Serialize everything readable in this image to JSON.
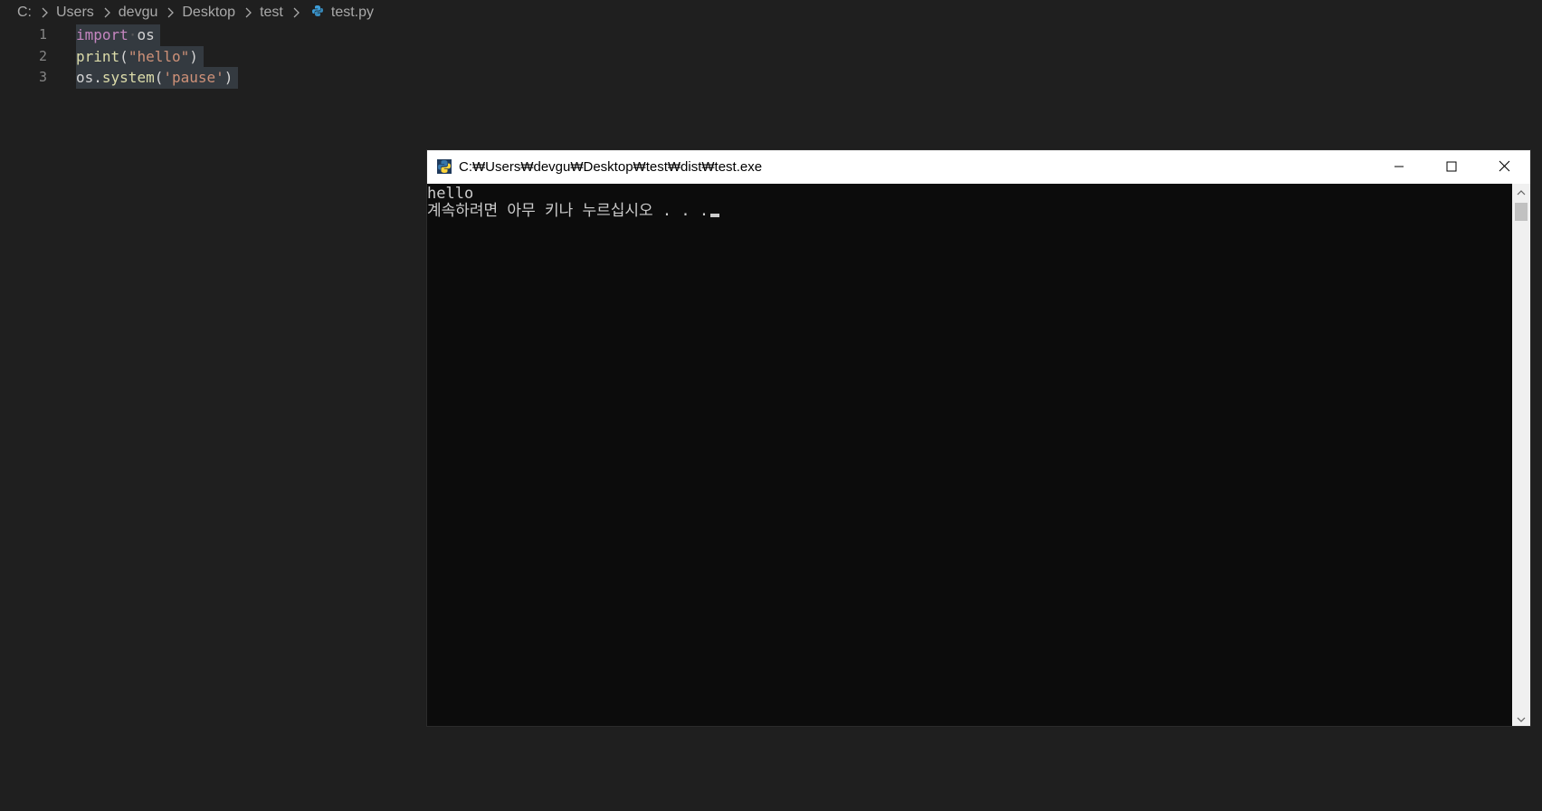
{
  "breadcrumb": {
    "items": [
      "C:",
      "Users",
      "devgu",
      "Desktop",
      "test"
    ],
    "file": "test.py"
  },
  "editor": {
    "lines": [
      {
        "number": "1",
        "tokens": [
          {
            "text": "import",
            "kind": "kw"
          },
          {
            "text": "·",
            "kind": "ws"
          },
          {
            "text": "os",
            "kind": "id"
          }
        ]
      },
      {
        "number": "2",
        "tokens": [
          {
            "text": "print",
            "kind": "fn"
          },
          {
            "text": "(",
            "kind": "id"
          },
          {
            "text": "\"hello\"",
            "kind": "str"
          },
          {
            "text": ")",
            "kind": "id"
          }
        ]
      },
      {
        "number": "3",
        "tokens": [
          {
            "text": "os.",
            "kind": "id"
          },
          {
            "text": "system",
            "kind": "fn"
          },
          {
            "text": "(",
            "kind": "id"
          },
          {
            "text": "'pause'",
            "kind": "str"
          },
          {
            "text": ")",
            "kind": "id"
          }
        ]
      }
    ]
  },
  "console": {
    "title": "C:₩Users₩devgu₩Desktop₩test₩dist₩test.exe",
    "output": [
      "hello",
      "계속하려면 아무 키나 누르십시오 . . ."
    ]
  },
  "colors": {
    "editor_bg": "#1f1f1f",
    "keyword": "#c586c0",
    "function": "#dcdcaa",
    "string": "#ce9178",
    "console_bg": "#0c0c0c",
    "console_text": "#cccccc",
    "python_icon": "#3c9cd7"
  },
  "icons": {
    "breadcrumb_separator": "chevron-right-icon",
    "file": "python-file-icon",
    "window_app": "python-app-icon",
    "minimize": "minimize-icon",
    "maximize": "maximize-icon",
    "close": "close-icon",
    "scroll_up": "arrow-up-icon",
    "scroll_down": "arrow-down-icon"
  }
}
